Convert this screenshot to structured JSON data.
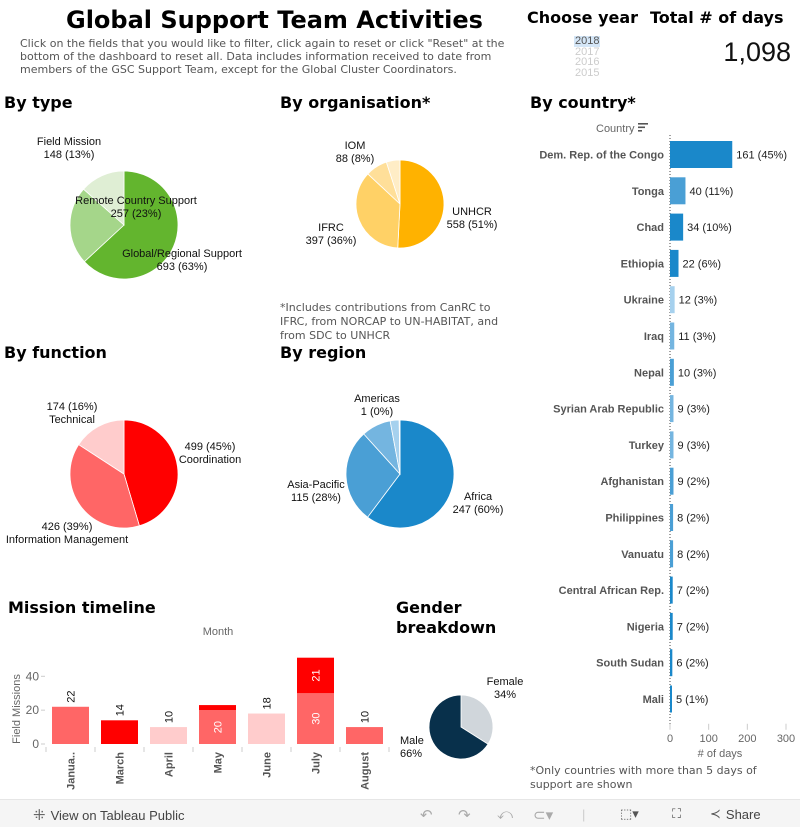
{
  "header": {
    "title": "Global Support Team Activities",
    "description": "Click on the fields that you would like to filter, click again to reset or click \"Reset\" at the bottom of the dashboard to reset all. Data includes information received to date from members of the GSC Support Team, except for the Global Cluster Coordinators."
  },
  "year_filter": {
    "title": "Choose year",
    "options": [
      "2018",
      "2017",
      "2016",
      "2015"
    ],
    "selected": "2018"
  },
  "total": {
    "title": "Total # of days",
    "value": "1,098"
  },
  "sections": {
    "by_type": "By type",
    "by_organisation": "By organisation*",
    "by_country": "By country*",
    "by_function": "By function",
    "by_region": "By region",
    "mission_timeline": "Mission timeline",
    "gender": "Gender breakdown"
  },
  "notes": {
    "organisation": "*Includes contributions from CanRC to IFRC, from NORCAP to UN-HABITAT, and from SDC to UNHCR",
    "country": "*Only countries with more than 5 days of support are shown"
  },
  "colors": {
    "green": [
      "#63b52e",
      "#a5d68a",
      "#dfeed4"
    ],
    "orange": [
      "#ffb200",
      "#ffd166",
      "#ffdf99",
      "#ffedc6"
    ],
    "red": [
      "#ff0000",
      "#ff6666",
      "#ffcccc"
    ],
    "blue": [
      "#1a88ca",
      "#4a9fd5",
      "#74b5e0",
      "#a6d1ee",
      "#d3e8f6"
    ],
    "gender": [
      "#d0d6db",
      "#08304b"
    ]
  },
  "chart_data": [
    {
      "id": "type",
      "type": "pie",
      "title": "By type",
      "slices": [
        {
          "label": "Global/Regional Support",
          "value": 693,
          "pct": "63%",
          "text": "693 (63%)"
        },
        {
          "label": "Remote Country Support",
          "value": 257,
          "pct": "23%",
          "text": "257 (23%)"
        },
        {
          "label": "Field Mission",
          "value": 148,
          "pct": "13%",
          "text": "148 (13%)"
        }
      ]
    },
    {
      "id": "organisation",
      "type": "pie",
      "title": "By organisation*",
      "slices": [
        {
          "label": "UNHCR",
          "value": 558,
          "pct": "51%",
          "text": "558 (51%)"
        },
        {
          "label": "IFRC",
          "value": 397,
          "pct": "36%",
          "text": "397 (36%)"
        },
        {
          "label": "IOM",
          "value": 88,
          "pct": "8%",
          "text": "88 (8%)"
        },
        {
          "label": "",
          "value": 55,
          "pct": "",
          "text": ""
        }
      ]
    },
    {
      "id": "function",
      "type": "pie",
      "title": "By function",
      "slices": [
        {
          "label": "Coordination",
          "value": 499,
          "pct": "45%",
          "text": "499 (45%)"
        },
        {
          "label": "Information Management",
          "value": 426,
          "pct": "39%",
          "text": "426 (39%)"
        },
        {
          "label": "Technical",
          "value": 174,
          "pct": "16%",
          "text": "174 (16%)"
        }
      ]
    },
    {
      "id": "region",
      "type": "pie",
      "title": "By region",
      "slices": [
        {
          "label": "Africa",
          "value": 247,
          "pct": "60%",
          "text": "247 (60%)"
        },
        {
          "label": "Asia-Pacific",
          "value": 115,
          "pct": "28%",
          "text": "115 (28%)"
        },
        {
          "label": "",
          "value": 36,
          "pct": "",
          "text": ""
        },
        {
          "label": "",
          "value": 11,
          "pct": "",
          "text": ""
        },
        {
          "label": "Americas",
          "value": 1,
          "pct": "0%",
          "text": "1 (0%)"
        }
      ]
    },
    {
      "id": "country",
      "type": "bar",
      "orientation": "horizontal",
      "title": "By country*",
      "ylabel": "Country",
      "xlabel": "# of days",
      "xlim": [
        0,
        300
      ],
      "xticks": [
        0,
        100,
        200,
        300
      ],
      "categories": [
        "Dem. Rep. of the Congo",
        "Tonga",
        "Chad",
        "Ethiopia",
        "Ukraine",
        "Iraq",
        "Nepal",
        "Syrian Arab Republic",
        "Turkey",
        "Afghanistan",
        "Philippines",
        "Vanuatu",
        "Central African Rep.",
        "Nigeria",
        "South Sudan",
        "Mali"
      ],
      "values": [
        161,
        40,
        34,
        22,
        12,
        11,
        10,
        9,
        9,
        9,
        8,
        8,
        7,
        7,
        6,
        5
      ],
      "labels": [
        "161 (45%)",
        "40 (11%)",
        "34 (10%)",
        "22 (6%)",
        "12 (3%)",
        "11 (3%)",
        "10 (3%)",
        "9 (3%)",
        "9 (3%)",
        "9 (2%)",
        "8 (2%)",
        "8 (2%)",
        "7 (2%)",
        "7 (2%)",
        "6 (2%)",
        "5 (1%)"
      ],
      "region_color_index": [
        0,
        1,
        0,
        0,
        3,
        2,
        1,
        2,
        2,
        1,
        1,
        1,
        0,
        0,
        0,
        0
      ]
    },
    {
      "id": "timeline",
      "type": "bar",
      "orientation": "vertical-stacked",
      "title": "Mission timeline",
      "xlabel": "Month",
      "ylabel": "Field Missions",
      "ylim": [
        0,
        52
      ],
      "yticks": [
        0,
        20,
        40
      ],
      "categories": [
        "Janua..",
        "March",
        "April",
        "May",
        "June",
        "July",
        "August"
      ],
      "series": [
        {
          "name": "base",
          "color_index": 1,
          "values": [
            22,
            0,
            0,
            20,
            0,
            30,
            10
          ]
        },
        {
          "name": "top",
          "color_index": 0,
          "values": [
            0,
            14,
            0,
            3,
            0,
            21,
            0
          ]
        },
        {
          "name": "light",
          "color_index": 2,
          "values": [
            0,
            0,
            10,
            0,
            18,
            0,
            0
          ]
        }
      ],
      "top_labels": [
        "22",
        "14",
        "10",
        "",
        "18",
        "",
        "10"
      ],
      "inner_labels": [
        {
          "month": "May",
          "series": "base",
          "text": "20"
        },
        {
          "month": "July",
          "series": "base",
          "text": "30"
        },
        {
          "month": "July",
          "series": "top",
          "text": "21"
        }
      ]
    },
    {
      "id": "gender",
      "type": "pie",
      "title": "Gender breakdown",
      "slices": [
        {
          "label": "Female",
          "value": 34,
          "pct": "34%",
          "text": "34%"
        },
        {
          "label": "Male",
          "value": 66,
          "pct": "66%",
          "text": "66%"
        }
      ]
    }
  ],
  "toolbar": {
    "view_on_label": "View on Tableau Public",
    "share_label": "Share",
    "icons": [
      "tableau-logo-icon",
      "undo-icon",
      "redo-icon",
      "revert-icon",
      "refresh-icon",
      "download-icon",
      "fullscreen-icon",
      "share-icon"
    ]
  }
}
